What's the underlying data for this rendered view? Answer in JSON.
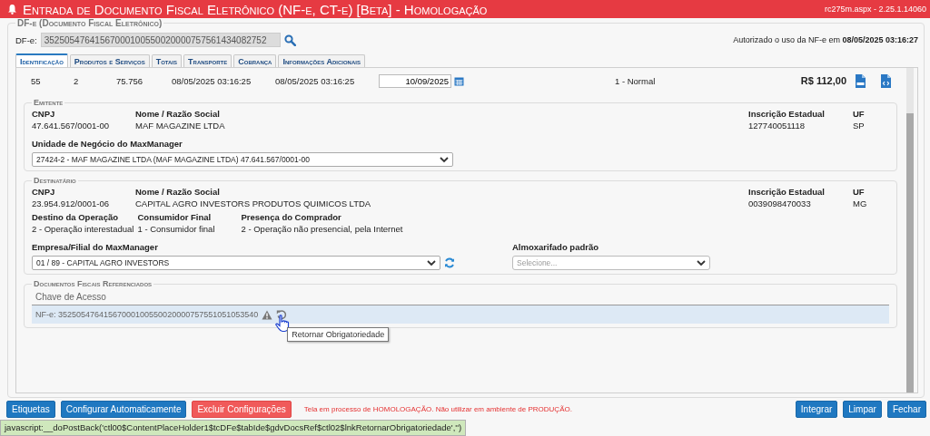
{
  "title_bar": {
    "title": "Entrada de Documento Fiscal Eletrônico (NF-e, CT-e) [Beta] - Homologação",
    "page_info": "rc275m.aspx - 2.25.1.14060"
  },
  "dfe": {
    "legend": "DF-e (Documento Fiscal Eletrônico)",
    "label": "DF-e:",
    "key": "35250547641567000100550020000757561434082752",
    "authorization": "Autorizado o uso da NF-e em **08/05/2025 03:16:27**"
  },
  "tabs": [
    {
      "label": "Identificação",
      "selected": true
    },
    {
      "label": "Produtos e Serviços",
      "selected": false
    },
    {
      "label": "Totais",
      "selected": false
    },
    {
      "label": "Transporte",
      "selected": false
    },
    {
      "label": "Cobrança",
      "selected": false
    },
    {
      "label": "Informações Adicionais",
      "selected": false
    }
  ],
  "identification": [
    {
      "kind": "text",
      "value": "55"
    },
    {
      "kind": "text",
      "value": "2"
    },
    {
      "kind": "text",
      "value": "75.756"
    },
    {
      "kind": "text",
      "value": "08/05/2025 03:16:25"
    },
    {
      "kind": "text",
      "value": "08/05/2025 03:16:25"
    },
    {
      "kind": "date",
      "value": "10/09/2025"
    },
    {
      "kind": "text",
      "value": "1 - Normal"
    },
    {
      "kind": "amount",
      "value": "R$ 112,00"
    },
    {
      "kind": "danfe"
    },
    {
      "kind": "xml"
    }
  ],
  "emitente": {
    "legend": "Emitente",
    "fields": [
      {
        "label": "CNPJ",
        "value": "47.641.567/0001-00"
      },
      {
        "label": "Nome / Razão Social",
        "value": "MAF MAGAZINE LTDA"
      },
      {
        "label": "Inscrição Estadual",
        "value": "127740051118"
      },
      {
        "label": "UF",
        "value": "SP"
      }
    ],
    "dropdown": {
      "label": "Unidade de Negócio do MaxManager",
      "value": "27424-2 - MAF MAGAZINE LTDA (MAF MAGAZINE LTDA) 47.641.567/0001-00"
    }
  },
  "destinatario": {
    "legend": "Destinatário",
    "fields": [
      {
        "label": "CNPJ",
        "value": "23.954.912/0001-06"
      },
      {
        "label": "Nome / Razão Social",
        "value": "CAPITAL AGRO INVESTORS PRODUTOS QUIMICOS LTDA"
      },
      {
        "label": "Inscrição Estadual",
        "value": "0039098470033"
      },
      {
        "label": "UF",
        "value": "MG"
      }
    ],
    "operation_fields": [
      {
        "label": "Destino da Operação",
        "value": "2 - Operação interestadual"
      },
      {
        "label": "Consumidor Final",
        "value": "1 - Consumidor final"
      },
      {
        "label": "Presença do Comprador",
        "value": "2 - Operação não presencial, pela Internet"
      }
    ],
    "company_dropdown": {
      "label": "Empresa/Filial do MaxManager",
      "value": "01 / 89 - CAPITAL AGRO INVESTORS"
    },
    "warehouse_dropdown": {
      "label": "Almoxarifado padrão",
      "placeholder": "Selecione..."
    }
  },
  "referenced_documents": {
    "legend": "Documentos Fiscais Referenciados",
    "column": "Chave de Acesso",
    "rows": [
      {
        "key": "NF-e: 35250547641567000100550020000757551051053540"
      }
    ],
    "tooltip": "Retornar Obrigatoriedade"
  },
  "left_buttons": [
    {
      "label": "Etiquetas",
      "kind": "primary"
    },
    {
      "label": "Configurar Automaticamente",
      "kind": "primary"
    },
    {
      "label": "Excluir Configurações",
      "kind": "danger"
    }
  ],
  "warning": "Tela em processo de HOMOLOGAÇÃO. Não utilizar em ambiente de PRODUÇÃO.",
  "right_buttons": [
    {
      "label": "Integrar",
      "kind": "primary"
    },
    {
      "label": "Limpar",
      "kind": "primary"
    },
    {
      "label": "Fechar",
      "kind": "primary"
    }
  ],
  "status_bar": "javascript:__doPostBack('ctl00$ContentPlaceHolder1$tcDFe$tabIde$gdvDocsRef$ctl02$lnkRetornarObrigatoriedade','')"
}
